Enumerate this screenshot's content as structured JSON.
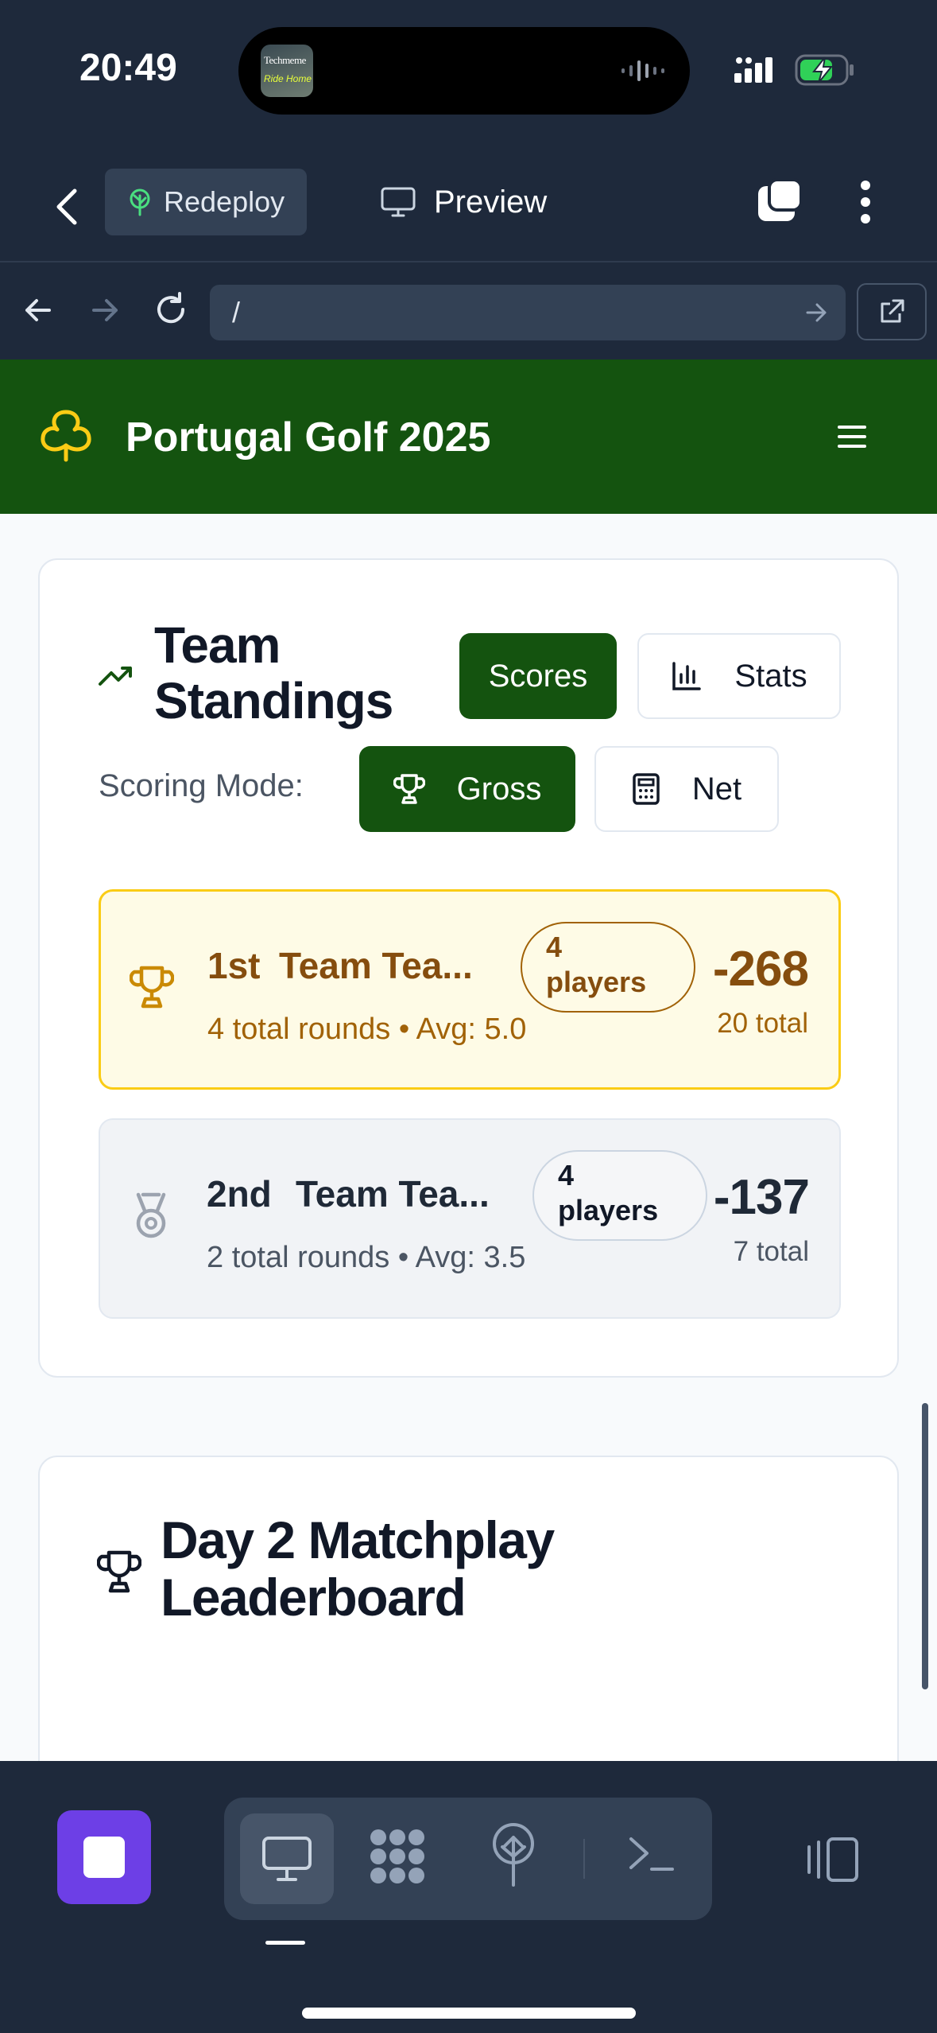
{
  "status_bar": {
    "time": "20:49",
    "now_playing_art": {
      "line1": "Techmeme",
      "line2": "Ride Home"
    },
    "battery_color": "#30d158"
  },
  "app_toolbar": {
    "redeploy_label": "Redeploy",
    "preview_label": "Preview"
  },
  "url_bar": {
    "url": "/"
  },
  "site": {
    "title": "Portugal Golf 2025",
    "brand_color": "#14530f"
  },
  "standings": {
    "title": "Team Standings",
    "tab_scores": "Scores",
    "tab_stats": "Stats",
    "scoring_mode_label": "Scoring Mode:",
    "mode_gross": "Gross",
    "mode_net": "Net",
    "teams": [
      {
        "rank": "1st",
        "name": "Team Tea...",
        "players_count": "4",
        "players_word": "players",
        "rounds": "4 total rounds",
        "avg": "Avg: 5.0",
        "score": "-268",
        "total": "20 total",
        "icon": "trophy-icon"
      },
      {
        "rank": "2nd",
        "name": "Team Tea...",
        "players_count": "4",
        "players_word": "players",
        "rounds": "2 total rounds",
        "avg": "Avg: 3.5",
        "score": "-137",
        "total": "7 total",
        "icon": "medal-icon"
      }
    ]
  },
  "matchplay": {
    "title": "Day 2 Matchplay Leaderboard"
  },
  "dock": {
    "stop_color": "#6d3fe6",
    "items": [
      "preview-icon",
      "apps-icon",
      "deploy-icon",
      "shell-icon"
    ]
  }
}
